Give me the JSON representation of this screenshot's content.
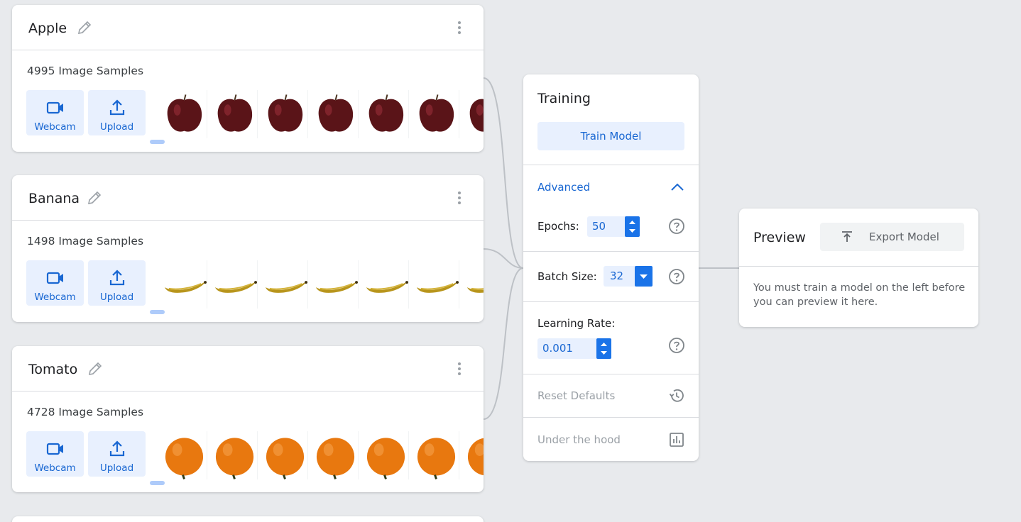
{
  "classes": [
    {
      "name": "Apple",
      "sample_count": "4995 Image Samples",
      "webcam_label": "Webcam",
      "upload_label": "Upload",
      "thumb_kind": "apple",
      "thumb_count": 7,
      "colors": {
        "fill": "#5a1418",
        "highlight": "#8e2a33"
      }
    },
    {
      "name": "Banana",
      "sample_count": "1498 Image Samples",
      "webcam_label": "Webcam",
      "upload_label": "Upload",
      "thumb_kind": "banana",
      "thumb_count": 7,
      "colors": {
        "fill": "#b8951c",
        "highlight": "#d4b33a"
      }
    },
    {
      "name": "Tomato",
      "sample_count": "4728 Image Samples",
      "webcam_label": "Webcam",
      "upload_label": "Upload",
      "thumb_kind": "tomato",
      "thumb_count": 7,
      "colors": {
        "fill": "#e8780f",
        "highlight": "#f5a04a"
      }
    }
  ],
  "training": {
    "title": "Training",
    "train_button": "Train Model",
    "advanced_label": "Advanced",
    "advanced_expanded": true,
    "epochs_label": "Epochs:",
    "epochs_value": "50",
    "batch_size_label": "Batch Size:",
    "batch_size_value": "32",
    "learning_rate_label": "Learning Rate:",
    "learning_rate_value": "0.001",
    "reset_label": "Reset Defaults",
    "hood_label": "Under the hood"
  },
  "preview": {
    "title": "Preview",
    "export_button": "Export Model",
    "message": "You must train a model on the left before you can preview it here."
  },
  "icons": {
    "edit": "pencil-icon",
    "more": "more-vert-icon",
    "webcam": "videocam-icon",
    "upload": "upload-icon",
    "help": "help-circle-icon",
    "reset": "history-icon",
    "hood": "bar-chart-icon",
    "export": "export-icon",
    "collapse": "chevron-up-icon"
  },
  "colors": {
    "accent": "#1a73e8",
    "accent_text": "#1967d2",
    "accent_light": "#e8f0fe",
    "background": "#e8eaed",
    "connector": "#bdc1c6"
  }
}
